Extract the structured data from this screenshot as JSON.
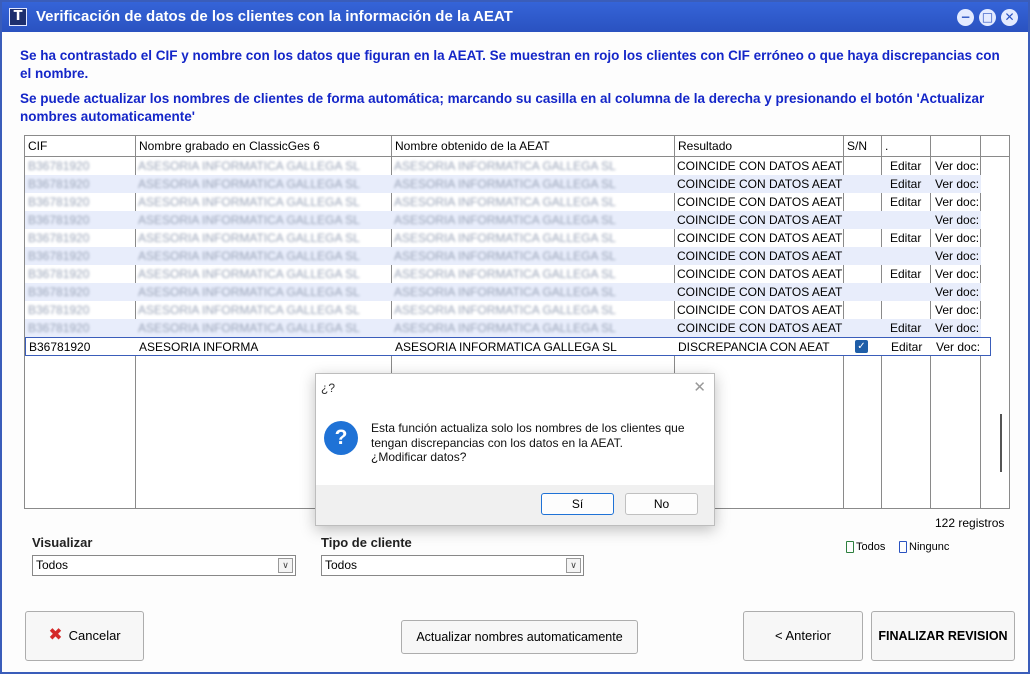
{
  "window": {
    "title": "Verificación de datos de los clientes con la información de la AEAT",
    "app_icon": "T",
    "controls": {
      "minimize": "−",
      "maximize": "□",
      "close": "✕"
    }
  },
  "info": {
    "line1": "Se ha contrastado el CIF y nombre con los datos que figuran en la AEAT. Se muestran en rojo los clientes con CIF erróneo o que haya discrepancias con el nombre.",
    "line2": "Se puede actualizar los nombres de clientes de forma automática; marcando su casilla en al columna de la  derecha y presionando el botón 'Actualizar nombres automaticamente'"
  },
  "grid": {
    "columns": [
      "CIF",
      "Nombre grabado en ClassicGes 6",
      "Nombre obtenido de la AEAT",
      "Resultado",
      "S/N",
      ".",
      ""
    ],
    "rows": [
      {
        "cif": "B36781920",
        "nombre": "ASESORIA INFORMATICA GALLEGA SL",
        "aeat": "ASESORIA INFORMATICA GALLEGA SL",
        "resultado": "COINCIDE CON DATOS AEAT",
        "editar": "Editar",
        "doc": "Ver doc:"
      },
      {
        "cif": "B36781920",
        "nombre": "ASESORIA INFORMATICA GALLEGA SL",
        "aeat": "ASESORIA INFORMATICA GALLEGA SL",
        "resultado": "COINCIDE CON DATOS AEAT",
        "editar": "Editar",
        "doc": "Ver doc:"
      },
      {
        "cif": "B36781920",
        "nombre": "ASESORIA INFORMATICA GALLEGA SL",
        "aeat": "ASESORIA INFORMATICA GALLEGA SL",
        "resultado": "COINCIDE CON DATOS AEAT",
        "editar": "Editar",
        "doc": "Ver doc:"
      },
      {
        "cif": "B36781920",
        "nombre": "ASESORIA INFORMATICA GALLEGA SL",
        "aeat": "ASESORIA INFORMATICA GALLEGA SL",
        "resultado": "COINCIDE CON DATOS AEAT",
        "editar": "",
        "doc": "Ver doc:"
      },
      {
        "cif": "B36781920",
        "nombre": "ASESORIA INFORMATICA GALLEGA SL",
        "aeat": "ASESORIA INFORMATICA GALLEGA SL",
        "resultado": "COINCIDE CON DATOS AEAT",
        "editar": "Editar",
        "doc": "Ver doc:"
      },
      {
        "cif": "B36781920",
        "nombre": "ASESORIA INFORMATICA GALLEGA SL",
        "aeat": "ASESORIA INFORMATICA GALLEGA SL",
        "resultado": "COINCIDE CON DATOS AEAT",
        "editar": "",
        "doc": "Ver doc:"
      },
      {
        "cif": "B36781920",
        "nombre": "ASESORIA INFORMATICA GALLEGA SL",
        "aeat": "ASESORIA INFORMATICA GALLEGA SL",
        "resultado": "COINCIDE CON DATOS AEAT",
        "editar": "Editar",
        "doc": "Ver doc:"
      },
      {
        "cif": "B36781920",
        "nombre": "ASESORIA INFORMATICA GALLEGA SL",
        "aeat": "ASESORIA INFORMATICA GALLEGA SL",
        "resultado": "COINCIDE CON DATOS AEAT",
        "editar": "",
        "doc": "Ver doc:"
      },
      {
        "cif": "B36781920",
        "nombre": "ASESORIA INFORMATICA GALLEGA SL",
        "aeat": "ASESORIA INFORMATICA GALLEGA SL",
        "resultado": "COINCIDE CON DATOS AEAT",
        "editar": "",
        "doc": "Ver doc:"
      },
      {
        "cif": "B36781920",
        "nombre": "ASESORIA INFORMATICA GALLEGA SL",
        "aeat": "ASESORIA INFORMATICA GALLEGA SL",
        "resultado": "COINCIDE CON DATOS AEAT",
        "editar": "Editar",
        "doc": "Ver doc:"
      }
    ],
    "selected_row": {
      "cif": "B36781920",
      "nombre": "ASESORIA INFORMA",
      "aeat": "ASESORIA INFORMATICA GALLEGA SL",
      "resultado": "DISCREPANCIA CON AEAT",
      "checked": "✓",
      "editar": "Editar",
      "doc": "Ver doc:"
    },
    "record_count": "122 registros"
  },
  "filters": {
    "visualizar_label": "Visualizar",
    "visualizar_value": "Todos",
    "tipo_label": "Tipo de cliente",
    "tipo_value": "Todos",
    "dropdown_arrow": "∨",
    "todos_link": "Todos",
    "ninguno_link": "Ningunc"
  },
  "buttons": {
    "cancelar": "Cancelar",
    "cancel_icon": "✖",
    "actualizar": "Actualizar nombres automaticamente",
    "anterior": "< Anterior",
    "finalizar": "FINALIZAR REVISION"
  },
  "dialog": {
    "title": "¿?",
    "close": "✕",
    "icon": "?",
    "message_line1": "Esta función actualiza solo los nombres de los clientes que",
    "message_line2": "tengan discrepancias con los datos en la AEAT.",
    "message_line3": "¿Modificar datos?",
    "yes": "Sí",
    "no": "No"
  },
  "colors": {
    "title_bar": "#2a52c0",
    "info_text": "#1426c8",
    "row_stripe": "#e8edfb",
    "checkbox": "#1f5ea8",
    "cancel_icon": "#d42a2a",
    "dialog_icon": "#1f72d6"
  }
}
